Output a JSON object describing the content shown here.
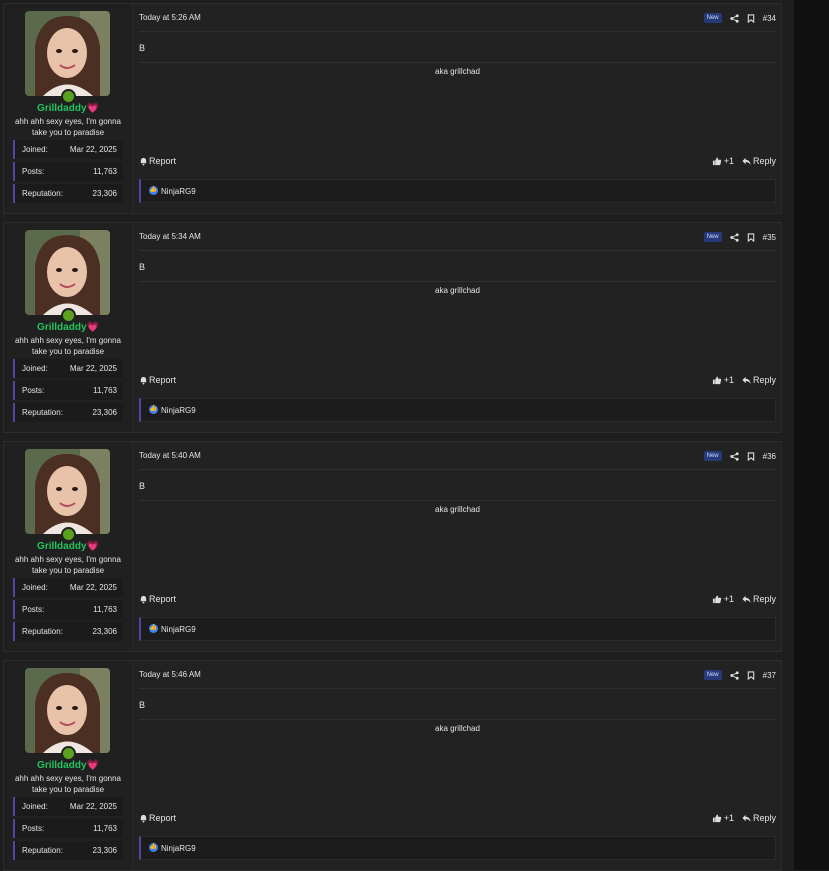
{
  "user": {
    "name": "Grilldaddy",
    "title": "ahh ahh sexy eyes, I'm gonna take you to paradise",
    "stats": [
      {
        "label": "Joined:",
        "value": "Mar 22, 2025"
      },
      {
        "label": "Posts:",
        "value": "11,763"
      },
      {
        "label": "Reputation:",
        "value": "23,306"
      }
    ]
  },
  "colors": {
    "username": "#22c55e",
    "heart": "#ec4899",
    "online": "#5aa11f",
    "accent": "#4f46a5",
    "new_badge": "#263a7a"
  },
  "icons": [
    "share-icon",
    "bookmark-icon",
    "bell-icon",
    "thumbs-up-icon",
    "reply-icon",
    "like-reaction-icon",
    "heart-icon"
  ],
  "posts": [
    {
      "time": "Today at 5:26 AM",
      "badge": "New",
      "number": "#34",
      "body": "B",
      "signature": "aka grillchad",
      "report": "Report",
      "plus": "+1",
      "reply": "Reply",
      "reactor": "NinjaRG9"
    },
    {
      "time": "Today at 5:34 AM",
      "badge": "New",
      "number": "#35",
      "body": "B",
      "signature": "aka grillchad",
      "report": "Report",
      "plus": "+1",
      "reply": "Reply",
      "reactor": "NinjaRG9"
    },
    {
      "time": "Today at 5:40 AM",
      "badge": "New",
      "number": "#36",
      "body": "B",
      "signature": "aka grillchad",
      "report": "Report",
      "plus": "+1",
      "reply": "Reply",
      "reactor": "NinjaRG9"
    },
    {
      "time": "Today at 5:46 AM",
      "badge": "New",
      "number": "#37",
      "body": "B",
      "signature": "aka grillchad",
      "report": "Report",
      "plus": "+1",
      "reply": "Reply",
      "reactor": "NinjaRG9"
    }
  ]
}
